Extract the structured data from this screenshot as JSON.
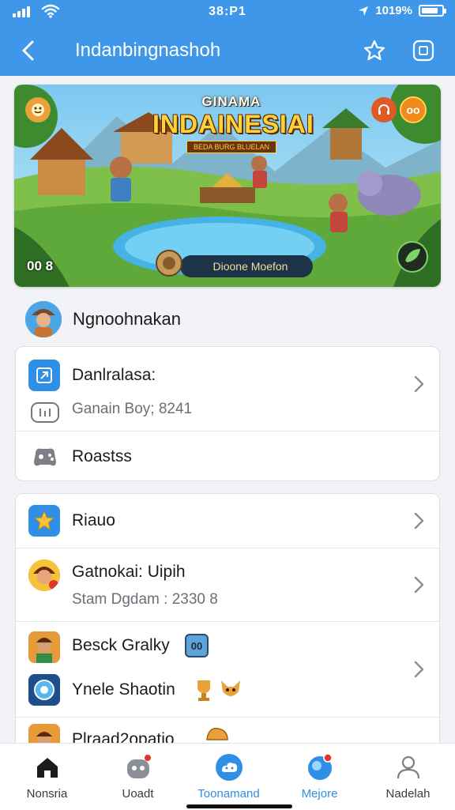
{
  "status_bar": {
    "time": "38:P1",
    "battery": "1019%",
    "battery_level": 0.85
  },
  "header": {
    "title": "Indanbingnashoh"
  },
  "banner": {
    "title_small": "GINAMA",
    "title_main": "INDAINESIAI",
    "title_sub": "BEDA BURG BLUELAN",
    "counter": "00 8",
    "cta_label": "Dioone Moefon",
    "badge_right": "oo"
  },
  "profile": {
    "name": "Ngnoohnakan"
  },
  "card1": {
    "row1": {
      "title": "Danlralasa:",
      "subtitle": "Ganain Boy; 8241"
    },
    "row2": {
      "title": "Roastss"
    }
  },
  "card2": {
    "row1": {
      "title": "Riauo"
    },
    "row2": {
      "title": "Gatnokai: Uipih",
      "subtitle": "Stam Dgdam : 2330 8"
    },
    "row3": {
      "title": "Besck Gralky",
      "badge": "00"
    },
    "row4": {
      "title": "Ynele Shaotin"
    },
    "row5": {
      "title": "Plraad2opatio"
    }
  },
  "tabs": [
    {
      "label": "Nonsria"
    },
    {
      "label": "Uoadt"
    },
    {
      "label": "Toonamand"
    },
    {
      "label": "Mejore"
    },
    {
      "label": "Nadelah"
    }
  ],
  "colors": {
    "header": "#3f97ea",
    "accent": "#2f8ee5",
    "background": "#f2f3f6"
  },
  "icons": [
    "signal-icon",
    "wifi-icon",
    "back-arrow-icon",
    "star-outline-icon",
    "share-square-icon",
    "chevron-right-icon",
    "home-icon",
    "robot-icon",
    "cloud-game-icon",
    "globe-icon",
    "person-icon"
  ]
}
